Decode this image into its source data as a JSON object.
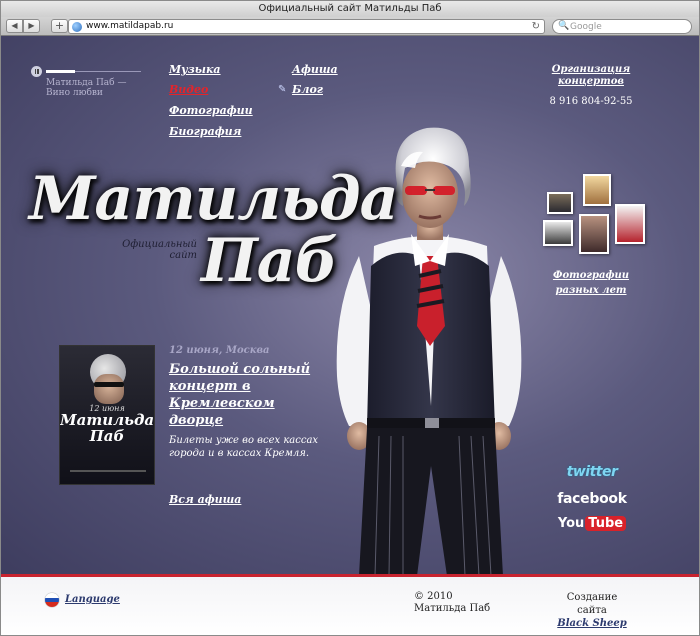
{
  "browser": {
    "window_title": "Официальный сайт Матильды Паб",
    "back_icon": "◀",
    "forward_icon": "▶",
    "add_icon": "+",
    "url": "www.matildapab.ru",
    "reload_icon": "↻",
    "search_placeholder": "Google",
    "search_icon": "🔍"
  },
  "player": {
    "track": "Матильда Паб — Вино любви",
    "progress": 0.3
  },
  "menu": {
    "music": "Музыка",
    "video": "Видео",
    "photos": "Фотографии",
    "biography": "Биография",
    "afisha": "Афиша",
    "blog": "Блог"
  },
  "contacts": {
    "org": "Организация концертов",
    "phone": "8 916 804-92-55"
  },
  "logo": {
    "first_name": "Матильда",
    "last_name": "Паб",
    "tagline": "Официальный сайт"
  },
  "photos_block": {
    "link": "Фотографии разных лет"
  },
  "event": {
    "poster_date": "12 июня",
    "poster_name": "Матильда Паб",
    "date": "12 июня, Москва",
    "title": "Большой сольный концерт в Кремлевском дворце",
    "desc": "Билеты уже во всех кассах города и в кассах Кремля.",
    "all": "Вся афиша"
  },
  "social": {
    "twitter": "twitter",
    "facebook": "facebook",
    "youtube_you": "You",
    "youtube_tube": "Tube"
  },
  "footer": {
    "language": "Language",
    "copyright_year": "© 2010",
    "copyright_name": "Матильда Паб",
    "credits_label": "Создание сайта",
    "credits_link": "Black Sheep"
  },
  "colors": {
    "accent_red": "#c8232f",
    "page_bg": "#5b5a7e",
    "link_dark": "#2c3a6e"
  }
}
